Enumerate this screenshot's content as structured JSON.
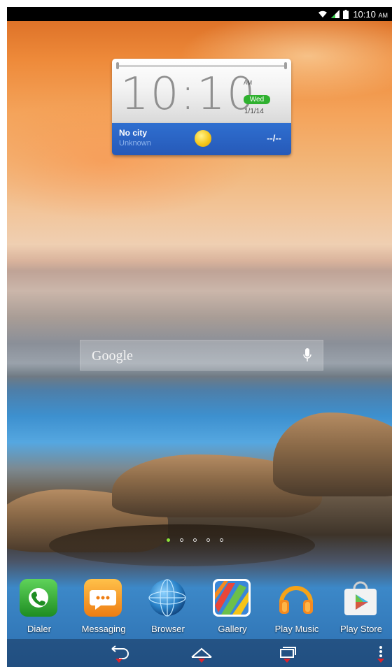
{
  "status_bar": {
    "time": "10:10",
    "ampm": "AM",
    "icons": [
      "wifi-icon",
      "cell-signal-icon",
      "battery-icon"
    ]
  },
  "clock_widget": {
    "time": "10:10",
    "ampm": "AM",
    "day": "Wed",
    "date": "1/1/14",
    "city": "No city",
    "condition": "Unknown",
    "temperature": "--/--",
    "weather_icon": "sun-icon",
    "day_color": "#2fb12f",
    "weather_bar_color": "#2f6fd0"
  },
  "search": {
    "label": "Google",
    "icon": "mic-icon"
  },
  "home_pages": {
    "count": 5,
    "current": 1
  },
  "dock": {
    "apps": [
      {
        "label": "Dialer",
        "icon": "phone-icon",
        "color": "#2aa82a"
      },
      {
        "label": "Messaging",
        "icon": "chat-bubble-icon",
        "color": "#f29a1f"
      },
      {
        "label": "Browser",
        "icon": "globe-icon",
        "color": "#2a83c9"
      },
      {
        "label": "Gallery",
        "icon": "gallery-icon",
        "color": "#e9463a"
      },
      {
        "label": "Play Music",
        "icon": "headphones-icon",
        "color": "#f5a318"
      },
      {
        "label": "Play Store",
        "icon": "shopping-bag-icon",
        "color": "#3fb8e6"
      }
    ]
  },
  "nav_bar": {
    "buttons": [
      "back-icon",
      "home-icon",
      "recent-apps-icon",
      "menu-icon"
    ],
    "accent": "#e0222a"
  }
}
